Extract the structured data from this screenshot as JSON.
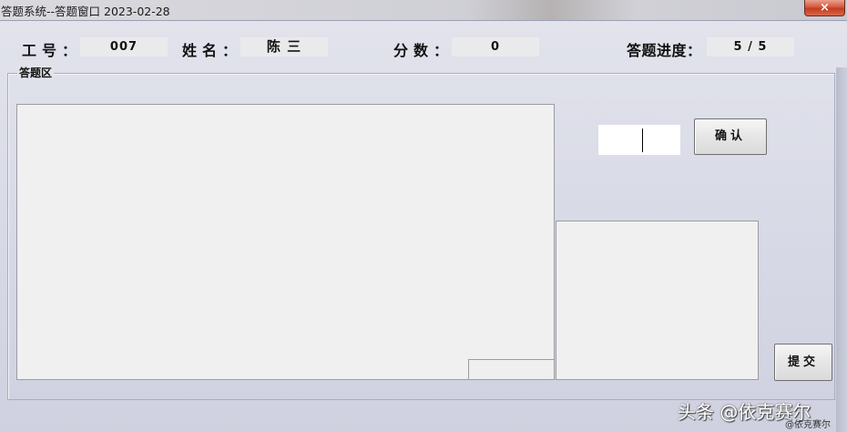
{
  "window": {
    "title": "答题系统--答题窗口 2023-02-28",
    "close_label": "×"
  },
  "header": {
    "employee_id_label": "工号：",
    "employee_id_value": "007",
    "name_label": "姓名：",
    "name_value": "陈 三",
    "score_label": "分数：",
    "score_value": "0",
    "progress_label": "答题进度：",
    "progress_value": "5 / 5"
  },
  "answer_area": {
    "group_title": "答题区",
    "question_text": "",
    "answer_input_value": "",
    "confirm_label": "确认",
    "feedback_text": "",
    "submit_label": "提交"
  },
  "watermark": {
    "main": "头条 @依克赛尔",
    "small": "@依克赛尔"
  }
}
